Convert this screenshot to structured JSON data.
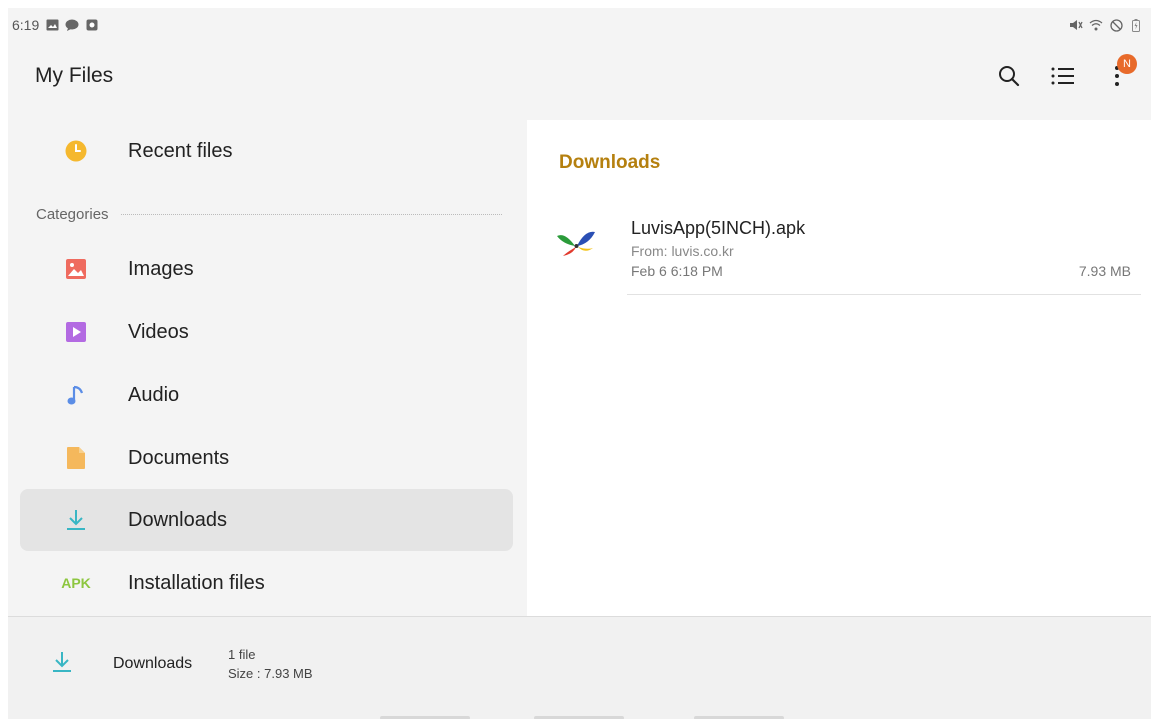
{
  "status_bar": {
    "time": "6:19",
    "left_icons": [
      "gallery-icon",
      "message-icon",
      "screenshot-icon"
    ],
    "right_icons": [
      "mute-icon",
      "wifi-icon",
      "dnd-icon",
      "battery-icon"
    ]
  },
  "app_bar": {
    "title": "My Files",
    "notification_badge": "N",
    "actions": [
      "search-icon",
      "list-view-icon",
      "more-options-icon"
    ]
  },
  "sidebar": {
    "recent": {
      "label": "Recent files",
      "icon": "clock-icon",
      "color": "#f5b82e"
    },
    "categories_label": "Categories",
    "items": [
      {
        "label": "Images",
        "icon": "image-icon",
        "color": "#ef6b5f"
      },
      {
        "label": "Videos",
        "icon": "video-icon",
        "color": "#b36ae2"
      },
      {
        "label": "Audio",
        "icon": "music-note-icon",
        "color": "#5b8de6"
      },
      {
        "label": "Documents",
        "icon": "document-icon",
        "color": "#f5b85c"
      },
      {
        "label": "Downloads",
        "icon": "download-icon",
        "color": "#39b6c4",
        "selected": true
      },
      {
        "label": "Installation files",
        "icon": "apk-icon",
        "icon_text": "APK",
        "color": "#8dc63f"
      }
    ]
  },
  "content": {
    "title": "Downloads",
    "files": [
      {
        "name": "LuvisApp(5INCH).apk",
        "source": "From: luvis.co.kr",
        "date": "Feb 6 6:18 PM",
        "size": "7.93 MB",
        "icon": "luvis-app-icon"
      }
    ]
  },
  "bottom_bar": {
    "label": "Downloads",
    "count": "1 file",
    "size": "Size : 7.93 MB",
    "icon": "download-icon"
  },
  "colors": {
    "accent": "#b5800f",
    "selected_bg": "#e4e4e4",
    "panel_bg": "#f4f4f4"
  }
}
